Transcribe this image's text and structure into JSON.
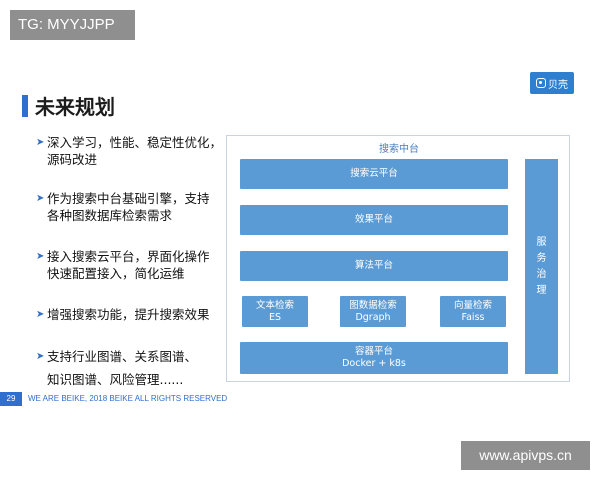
{
  "watermarks": {
    "top_left": "TG: MYYJJPP",
    "bottom_right": "www.apivps.cn"
  },
  "logo": {
    "text": "贝壳",
    "icon": "beike-logo-icon"
  },
  "slide": {
    "title": "未来规划",
    "bullets": [
      {
        "lines": [
          "深入学习，性能、稳定性优化，",
          "源码改进"
        ]
      },
      {
        "lines": [
          "作为搜索中台基础引擎，支持",
          "各种图数据库检索需求"
        ]
      },
      {
        "lines": [
          "接入搜索云平台，界面化操作",
          "快速配置接入，简化运维"
        ]
      },
      {
        "lines": [
          "增强搜索功能，提升搜索效果"
        ]
      },
      {
        "lines": [
          "支持行业图谱、关系图谱、",
          "知识图谱、风险管理......"
        ]
      }
    ],
    "bullet_icon": "arrow-right-icon"
  },
  "diagram": {
    "title": "搜索中台",
    "layers": {
      "cloud": "搜索云平台",
      "effect": "效果平台",
      "algorithm": "算法平台",
      "text_search": {
        "name": "文本检索",
        "tech": "ES"
      },
      "graph_search": {
        "name": "图数据检索",
        "tech": "Dgraph"
      },
      "vector_search": {
        "name": "向量检索",
        "tech": "Faiss"
      },
      "container": {
        "name": "容器平台",
        "tech": "Docker + k8s"
      }
    },
    "side": [
      "服",
      "务",
      "治",
      "理"
    ]
  },
  "footer": {
    "page_number": "29",
    "text": "WE ARE BEIKE, 2018 BEIKE ALL RIGHTS RESERVED"
  },
  "colors": {
    "accent": "#2f6fce",
    "block": "#5b9bd5",
    "watermark_bg": "#8f8f8f"
  }
}
